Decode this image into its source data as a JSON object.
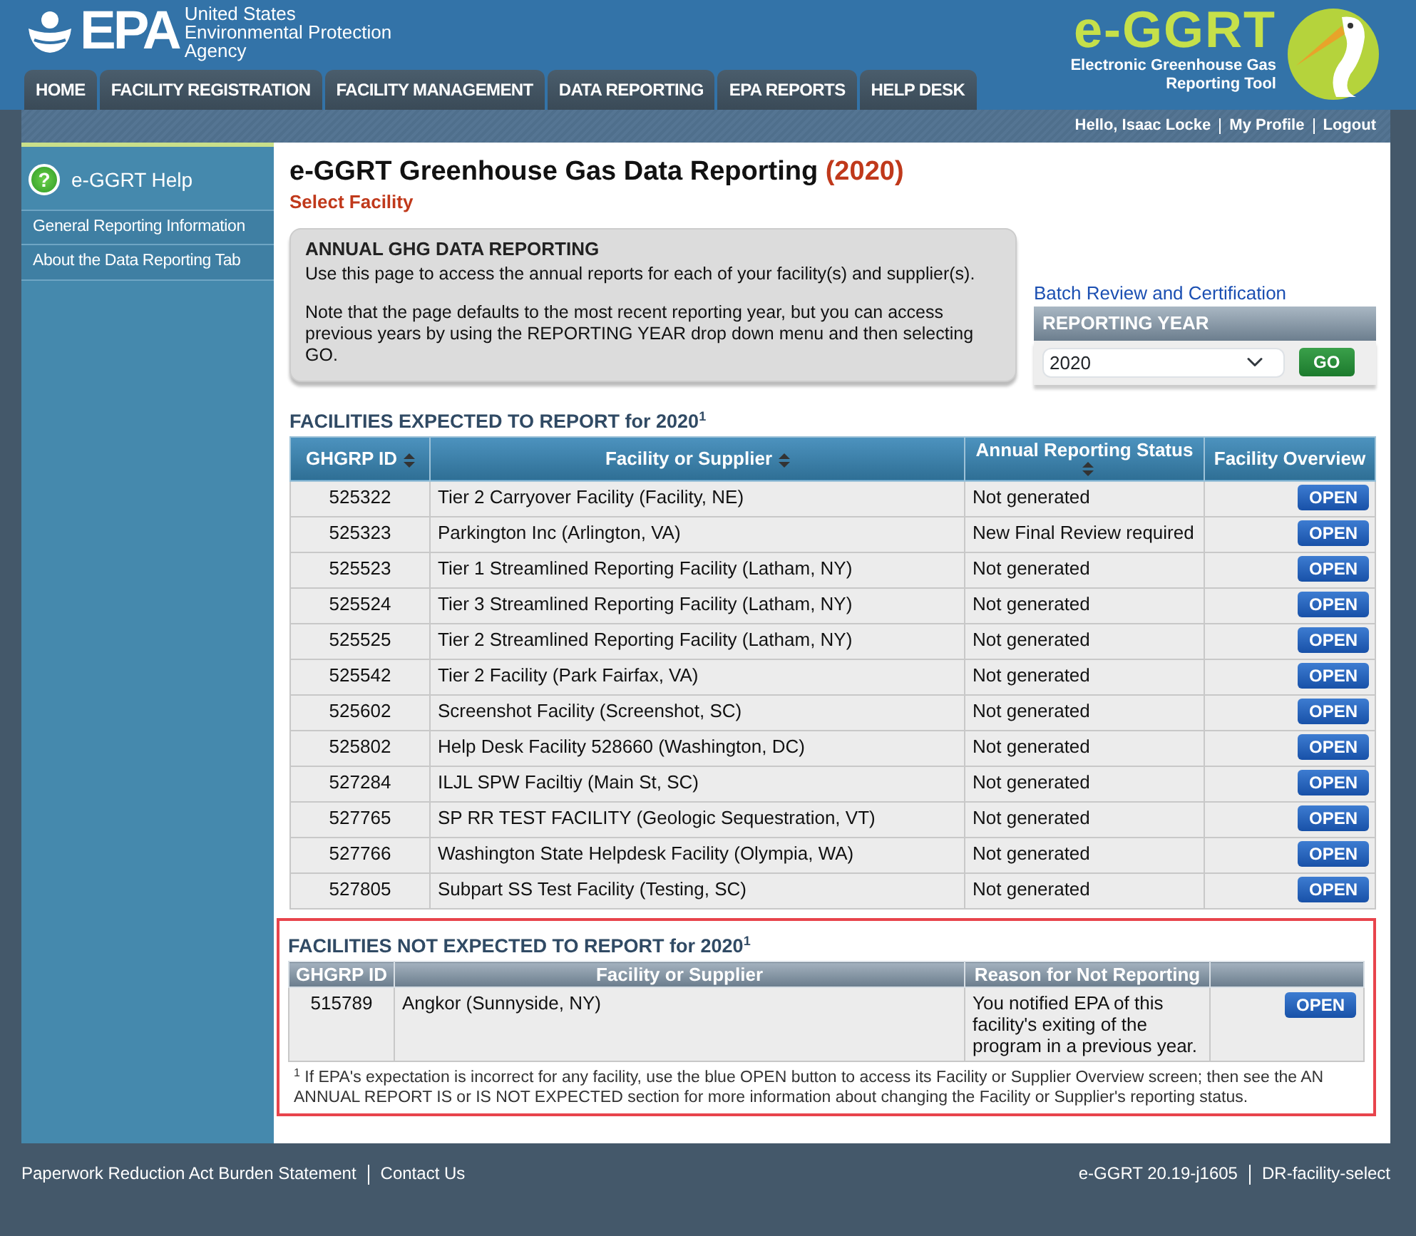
{
  "header": {
    "agency_mark": "EPA",
    "agency_name": [
      "United States",
      "Environmental Protection",
      "Agency"
    ],
    "tool_logo": "e-GGRT",
    "tool_name": [
      "Electronic Greenhouse Gas",
      "Reporting Tool"
    ]
  },
  "tabs": [
    "HOME",
    "FACILITY REGISTRATION",
    "FACILITY MANAGEMENT",
    "DATA REPORTING",
    "EPA REPORTS",
    "HELP DESK"
  ],
  "user_links": [
    "Hello, Isaac Locke",
    "My Profile",
    "Logout"
  ],
  "sidebar": {
    "help_icon": "?",
    "title": "e-GGRT Help",
    "items": [
      "General Reporting Information",
      "About the Data Reporting Tab"
    ]
  },
  "page": {
    "title": "e-GGRT Greenhouse Gas Data Reporting",
    "year": "(2020)",
    "subtitle": "Select Facility"
  },
  "info_box": {
    "heading": "ANNUAL GHG DATA REPORTING",
    "paragraphs": [
      "Use this page to access the annual reports for each of your facility(s) and supplier(s).",
      "Note that the page defaults to the most recent reporting year, but you can access previous years by using the REPORTING YEAR drop down menu and then selecting GO."
    ]
  },
  "batch_link": "Batch Review and Certification",
  "reporting_year": {
    "heading": "REPORTING YEAR",
    "value": "2020",
    "button": "GO"
  },
  "expected": {
    "heading": "FACILITIES EXPECTED TO REPORT for 2020$^{1}$",
    "columns": [
      "GHGRP ID",
      "Facility or Supplier",
      "Annual Reporting Status",
      "Facility Overview"
    ],
    "rows": [
      {
        "id": "525322",
        "facility": "Tier 2 Carryover Facility (Facility, NE)",
        "status": "Not generated",
        "action": "OPEN"
      },
      {
        "id": "525323",
        "facility": "Parkington Inc (Arlington, VA)",
        "status": "New Final Review required",
        "action": "OPEN"
      },
      {
        "id": "525523",
        "facility": "Tier 1 Streamlined Reporting Facility (Latham, NY)",
        "status": "Not generated",
        "action": "OPEN"
      },
      {
        "id": "525524",
        "facility": "Tier 3 Streamlined Reporting Facility (Latham, NY)",
        "status": "Not generated",
        "action": "OPEN"
      },
      {
        "id": "525525",
        "facility": "Tier 2 Streamlined Reporting Facility (Latham, NY)",
        "status": "Not generated",
        "action": "OPEN"
      },
      {
        "id": "525542",
        "facility": "Tier 2 Facility (Park Fairfax, VA)",
        "status": "Not generated",
        "action": "OPEN"
      },
      {
        "id": "525602",
        "facility": "Screenshot Facility (Screenshot, SC)",
        "status": "Not generated",
        "action": "OPEN"
      },
      {
        "id": "525802",
        "facility": "Help Desk Facility 528660 (Washington, DC)",
        "status": "Not generated",
        "action": "OPEN"
      },
      {
        "id": "527284",
        "facility": "ILJL SPW Faciltiy (Main St, SC)",
        "status": "Not generated",
        "action": "OPEN"
      },
      {
        "id": "527765",
        "facility": "SP RR TEST FACILITY (Geologic Sequestration, VT)",
        "status": "Not generated",
        "action": "OPEN"
      },
      {
        "id": "527766",
        "facility": "Washington State Helpdesk Facility (Olympia, WA)",
        "status": "Not generated",
        "action": "OPEN"
      },
      {
        "id": "527805",
        "facility": "Subpart SS Test Facility (Testing, SC)",
        "status": "Not generated",
        "action": "OPEN"
      }
    ]
  },
  "not_expected": {
    "heading": "FACILITIES NOT EXPECTED TO REPORT for 2020$^{1}$",
    "columns": [
      "GHGRP ID",
      "Facility or Supplier",
      "Reason for Not Reporting"
    ],
    "rows": [
      {
        "id": "515789",
        "facility": "Angkor (Sunnyside, NY)",
        "reason": "You notified EPA of this facility's exiting of the program in a previous year.",
        "action": "OPEN"
      }
    ],
    "footnote": "$^{1}$ If EPA's expectation is incorrect for any facility, use the blue OPEN button to access its Facility or Supplier Overview screen; then see the AN ANNUAL REPORT IS or IS NOT EXPECTED section for more information about changing the Facility or Supplier's reporting status."
  },
  "footer": {
    "left": [
      "Paperwork Reduction Act Burden Statement",
      "Contact Us"
    ],
    "right": [
      "e-GGRT 20.19-j1605",
      "DR-facility-select"
    ]
  }
}
